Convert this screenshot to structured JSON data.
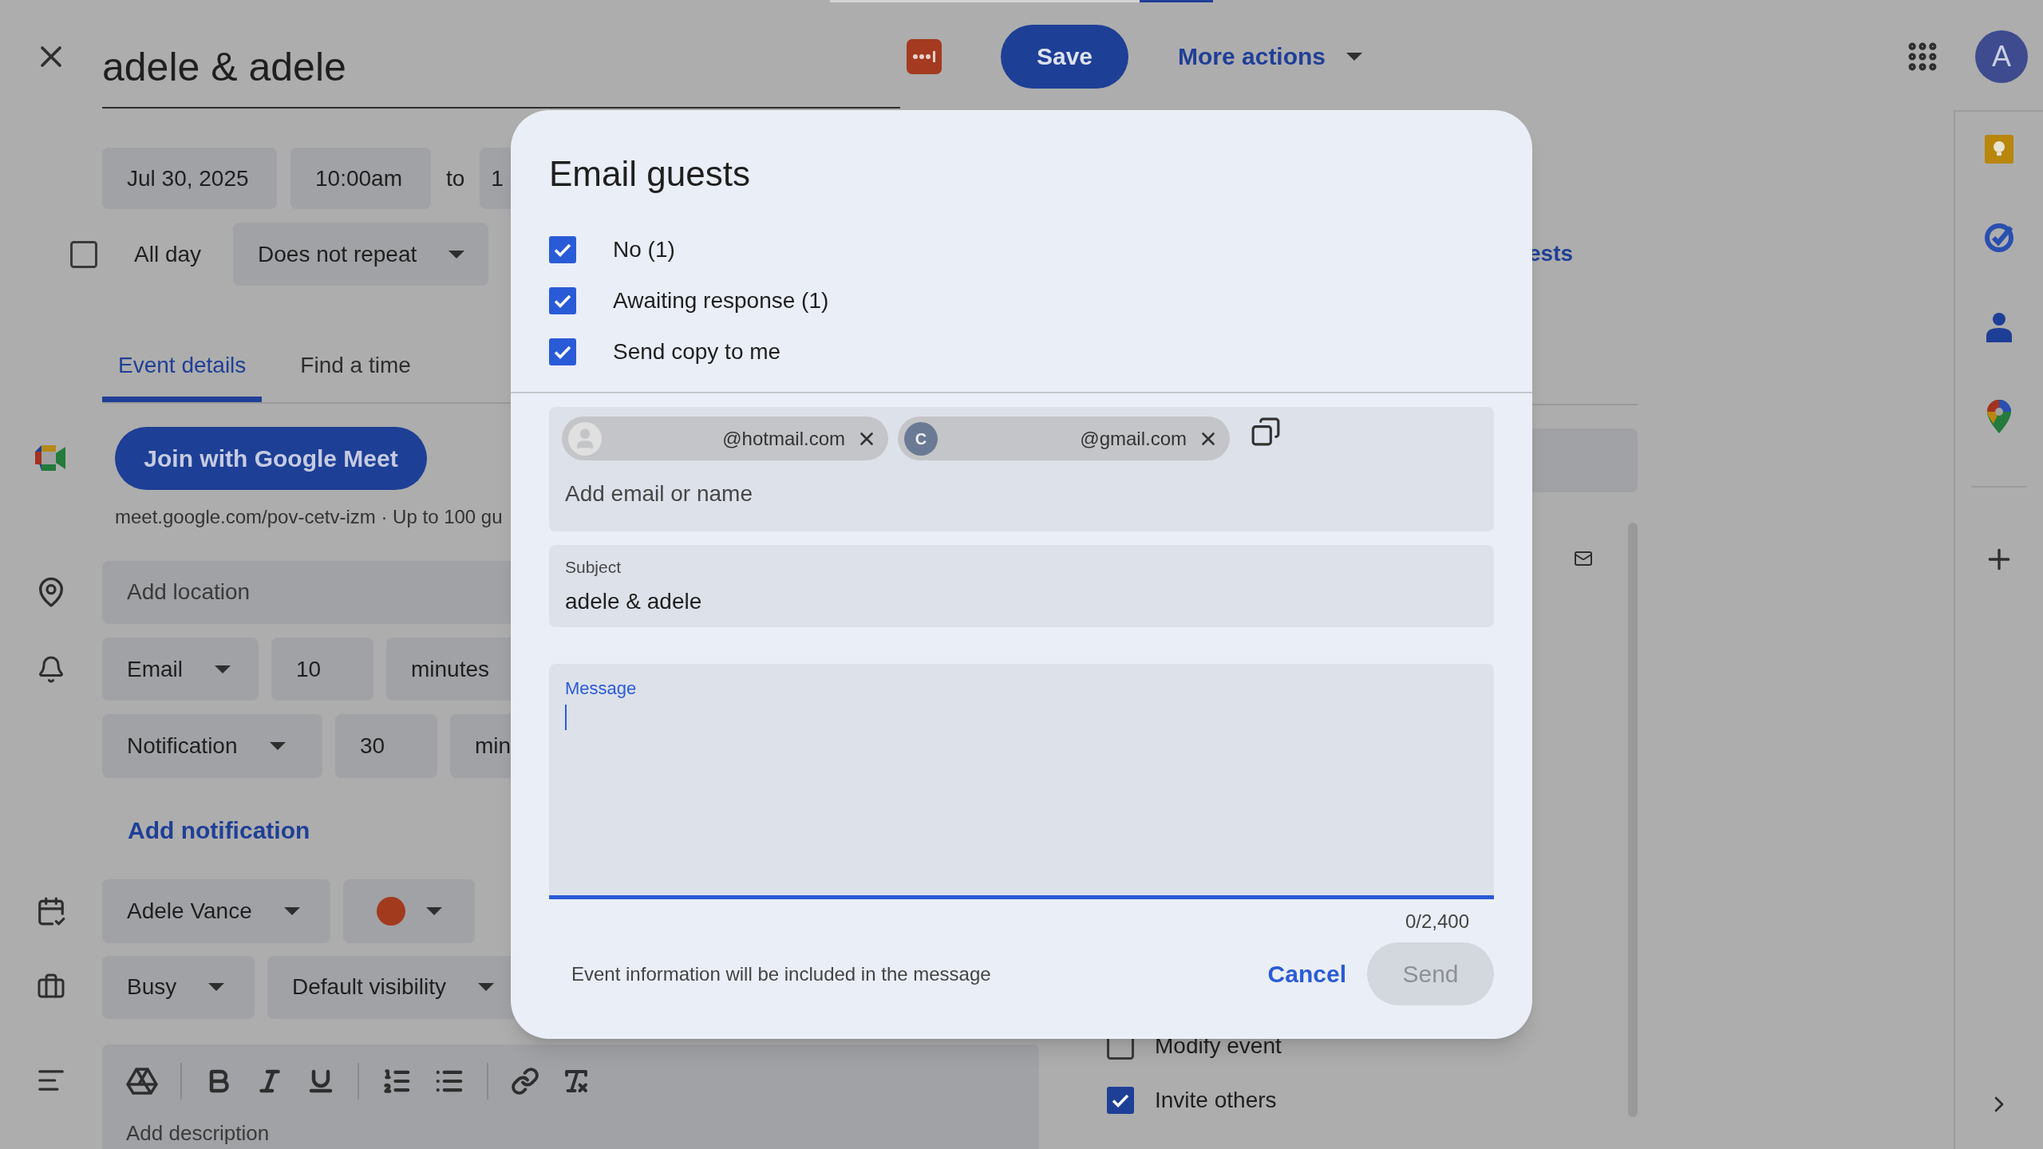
{
  "header": {
    "title": "adele & adele",
    "save": "Save",
    "more_actions": "More actions",
    "avatar": "A"
  },
  "date_row": {
    "date": "Jul 30, 2025",
    "start": "10:00am",
    "to": "to",
    "end": "1"
  },
  "all_day": {
    "label": "All day",
    "checked": false
  },
  "repeat": "Does not repeat",
  "tabs": [
    {
      "label": "Event details",
      "selected": true
    },
    {
      "label": "Find a time",
      "selected": false
    }
  ],
  "meet": {
    "button": "Join with Google Meet",
    "link": "meet.google.com/pov-cetv-izm · Up to 100 gu"
  },
  "location_placeholder": "Add location",
  "notifications": [
    {
      "type": "Email",
      "amount": "10",
      "unit": "minutes"
    },
    {
      "type": "Notification",
      "amount": "30",
      "unit": "min"
    }
  ],
  "add_notification": "Add notification",
  "calendar": {
    "name": "Adele Vance",
    "color": "#a23a1e"
  },
  "availability": {
    "status": "Busy",
    "visibility": "Default visibility"
  },
  "description": {
    "placeholder": "Add description"
  },
  "guests_panel": {
    "link": "ests",
    "permissions": [
      {
        "label": "Modify event",
        "checked": false
      },
      {
        "label": "Invite others",
        "checked": true
      }
    ]
  },
  "dialog": {
    "title": "Email guests",
    "options": [
      {
        "label": "No (1)",
        "checked": true
      },
      {
        "label": "Awaiting response (1)",
        "checked": true
      },
      {
        "label": "Send copy to me",
        "checked": true
      }
    ],
    "recipients": [
      {
        "kind": "silhouette",
        "email": "@hotmail.com"
      },
      {
        "kind": "initial",
        "initial": "C",
        "email": "@gmail.com"
      }
    ],
    "recipient_placeholder": "Add email or name",
    "subject": {
      "label": "Subject",
      "value": "adele & adele"
    },
    "message": {
      "label": "Message",
      "focused": true
    },
    "counter": "0/2,400",
    "note": "Event information will be included in the message",
    "cancel": "Cancel",
    "send": {
      "label": "Send",
      "disabled": true
    }
  }
}
